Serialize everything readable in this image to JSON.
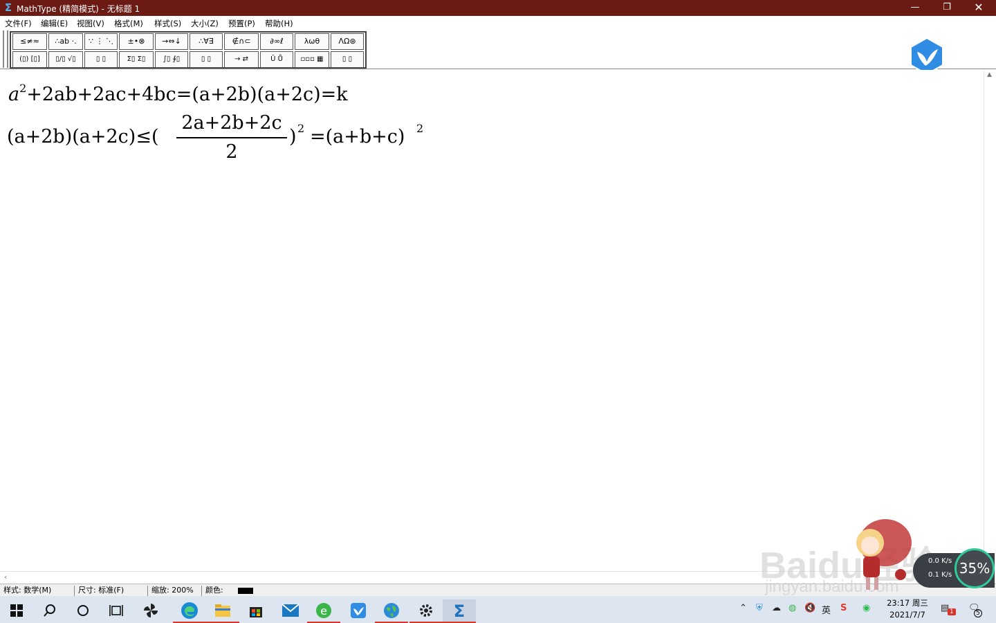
{
  "window": {
    "title": "MathType (精简模式) - 无标题 1",
    "app_icon": "sigma-icon"
  },
  "controls": {
    "minimize": "—",
    "maximize": "❐",
    "close": "✕"
  },
  "menu": [
    "文件(F)",
    "编辑(E)",
    "视图(V)",
    "格式(M)",
    "样式(S)",
    "大小(Z)",
    "预置(P)",
    "帮助(H)"
  ],
  "palette": {
    "row1": [
      "≤≠≈",
      "∴ab ·.",
      "∵ ⋮ ⋱",
      "±•⊗",
      "→⇔↓",
      "∴∀∃",
      "∉∩⊂",
      "∂∞ℓ",
      "λωθ",
      "ΛΩ⊛"
    ],
    "row2": [
      "(▯) [▯]",
      "▯/▯ √▯",
      "▯ ▯",
      "Σ▯ Σ▯",
      "∫▯ ∮▯",
      "▯ ▯",
      "→ ⇄",
      "Ū Ů",
      "▫▫▫ ▦",
      "▯ ▯"
    ]
  },
  "equations": {
    "eq1": {
      "a": "a",
      "sq": "2",
      "rest": "+2ab+2ac+4bc=(a+2b)(a+2c)=k"
    },
    "eq2": {
      "lhs": "(a+2b)(a+2c)≤(",
      "numerator": "2a+2b+2c",
      "denominator": "2",
      "rp": ")",
      "sq1": "2",
      "mid": "=(a+b+c)",
      "sq2": "2"
    }
  },
  "status": {
    "style": "样式: 数学(M)",
    "size": "尺寸: 标准(F)",
    "zoom": "缩放: 200%",
    "color": "颜色:"
  },
  "taskbar": {
    "icons": [
      "windows-start-icon",
      "search-icon",
      "cortana-icon",
      "task-view-icon",
      "pinwheel-icon",
      "edge-icon",
      "file-explorer-icon",
      "store-icon",
      "mail-icon",
      "ie-browser-icon",
      "bird-app-icon",
      "globe-icon",
      "settings-icon",
      "mathtype-icon"
    ],
    "clock_time": "23:17 周三",
    "clock_date": "2021/7/7",
    "ime": "英",
    "notification_badge": "1",
    "message_badge": "5"
  },
  "overlays": {
    "net_up": "0.0 K/s",
    "net_down": "0.1 K/s",
    "gauge": "35%",
    "watermark": "Baidu经验",
    "watermark_sub": "jingyan.baidu.com"
  }
}
